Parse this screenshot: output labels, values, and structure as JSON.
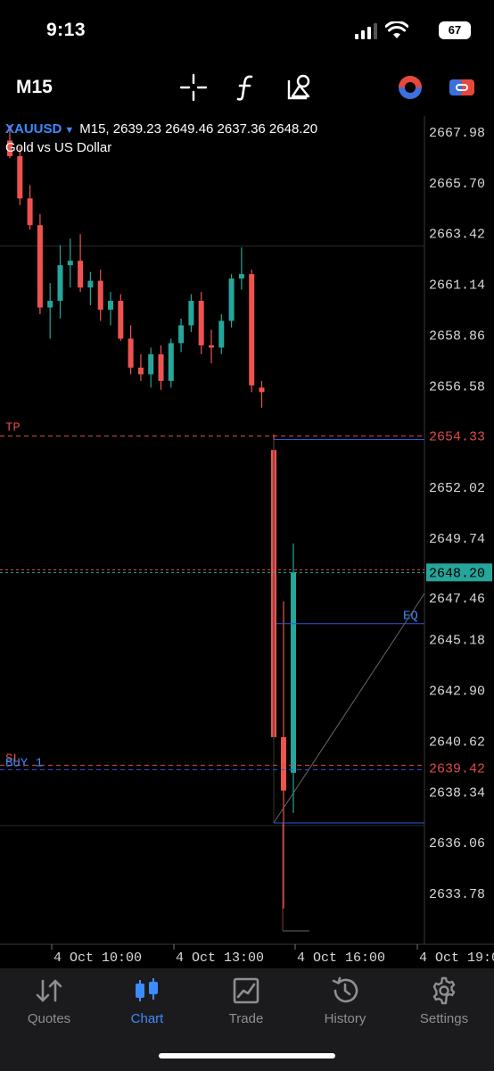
{
  "status_bar": {
    "time": "9:13",
    "battery": "67"
  },
  "toolbar": {
    "timeframe": "M15"
  },
  "symbol": {
    "name": "XAUUSD",
    "timeframe": "M15",
    "ohlc": "2639.23 2649.46 2637.36 2648.20",
    "description": "Gold vs US Dollar"
  },
  "price_axis": {
    "labels": [
      "2667.98",
      "2665.70",
      "2663.42",
      "2661.14",
      "2658.86",
      "2656.58",
      "2654.33",
      "2652.02",
      "2649.74",
      "2648.20",
      "2647.46",
      "2645.18",
      "2642.90",
      "2640.62",
      "2639.42",
      "2638.34",
      "2636.06",
      "2633.78"
    ]
  },
  "time_axis": {
    "labels": [
      "4 Oct 10:00",
      "4 Oct 13:00",
      "4 Oct 16:00",
      "4 Oct 19:0"
    ]
  },
  "lines": {
    "tp_label": "TP",
    "tp_price": "2654.33",
    "current_price": "2648.20",
    "eq_label": "EQ",
    "sl_label": "SL",
    "buy_label": "BUY 1",
    "buy_price": "2639.42"
  },
  "colors": {
    "bull": "#26a69a",
    "bear": "#ef5350",
    "accent": "#3d8bfd",
    "tp": "#e04a4a",
    "line_blue": "#2d5bd6"
  },
  "chart_data": {
    "type": "candlestick",
    "symbol": "XAUUSD",
    "timeframe": "M15",
    "ylim": [
      2632.5,
      2669.0
    ],
    "candles": [
      {
        "o": 2667.6,
        "h": 2668.3,
        "l": 2666.8,
        "c": 2666.9
      },
      {
        "o": 2666.9,
        "h": 2667.3,
        "l": 2664.7,
        "c": 2665.0
      },
      {
        "o": 2665.0,
        "h": 2665.6,
        "l": 2663.6,
        "c": 2663.8
      },
      {
        "o": 2663.8,
        "h": 2664.3,
        "l": 2659.8,
        "c": 2660.1
      },
      {
        "o": 2660.1,
        "h": 2661.2,
        "l": 2658.7,
        "c": 2660.4
      },
      {
        "o": 2660.4,
        "h": 2662.9,
        "l": 2659.6,
        "c": 2662.0
      },
      {
        "o": 2662.0,
        "h": 2663.2,
        "l": 2661.0,
        "c": 2662.2
      },
      {
        "o": 2662.2,
        "h": 2663.4,
        "l": 2660.8,
        "c": 2661.0
      },
      {
        "o": 2661.0,
        "h": 2661.7,
        "l": 2660.2,
        "c": 2661.3
      },
      {
        "o": 2661.3,
        "h": 2661.8,
        "l": 2659.5,
        "c": 2660.0
      },
      {
        "o": 2660.0,
        "h": 2660.8,
        "l": 2659.3,
        "c": 2660.4
      },
      {
        "o": 2660.4,
        "h": 2660.7,
        "l": 2658.6,
        "c": 2658.7
      },
      {
        "o": 2658.7,
        "h": 2659.3,
        "l": 2657.1,
        "c": 2657.4
      },
      {
        "o": 2657.4,
        "h": 2658.0,
        "l": 2656.8,
        "c": 2657.1
      },
      {
        "o": 2657.1,
        "h": 2658.3,
        "l": 2656.5,
        "c": 2658.0
      },
      {
        "o": 2658.0,
        "h": 2658.4,
        "l": 2656.4,
        "c": 2656.8
      },
      {
        "o": 2656.8,
        "h": 2658.7,
        "l": 2656.5,
        "c": 2658.5
      },
      {
        "o": 2658.5,
        "h": 2659.6,
        "l": 2658.1,
        "c": 2659.3
      },
      {
        "o": 2659.3,
        "h": 2660.7,
        "l": 2659.0,
        "c": 2660.4
      },
      {
        "o": 2660.4,
        "h": 2660.8,
        "l": 2658.0,
        "c": 2658.4
      },
      {
        "o": 2658.4,
        "h": 2659.1,
        "l": 2657.6,
        "c": 2658.3
      },
      {
        "o": 2658.3,
        "h": 2659.8,
        "l": 2658.0,
        "c": 2659.5
      },
      {
        "o": 2659.5,
        "h": 2661.6,
        "l": 2659.2,
        "c": 2661.4
      },
      {
        "o": 2661.4,
        "h": 2662.8,
        "l": 2660.9,
        "c": 2661.6
      },
      {
        "o": 2661.6,
        "h": 2661.8,
        "l": 2656.3,
        "c": 2656.6
      },
      {
        "o": 2656.5,
        "h": 2656.8,
        "l": 2655.6,
        "c": 2656.3
      },
      {
        "o": 2653.7,
        "h": 2654.4,
        "l": 2640.7,
        "c": 2640.8
      },
      {
        "o": 2640.8,
        "h": 2646.9,
        "l": 2633.1,
        "c": 2638.4
      },
      {
        "o": 2639.2,
        "h": 2649.5,
        "l": 2637.4,
        "c": 2648.2
      }
    ]
  }
}
